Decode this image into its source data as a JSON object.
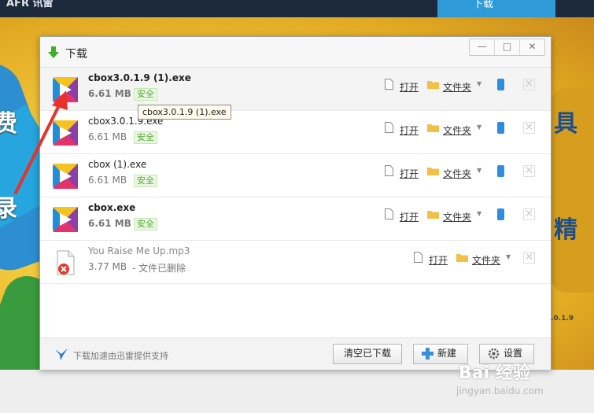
{
  "background_page": {
    "top_logo": "AFR 讯雷",
    "top_tab": "下载",
    "banner_words": [
      "费",
      "录",
      "具",
      "精"
    ],
    "banner_version": ".0.1.9"
  },
  "dialog": {
    "title": "下载",
    "window_buttons": {
      "minimize": "—",
      "maximize": "□",
      "close": "✕"
    },
    "tooltip": "cbox3.0.1.9 (1).exe",
    "files": [
      {
        "name": "cbox3.0.1.9 (1).exe",
        "size": "6.61 MB",
        "status": "安全",
        "open_label": "打开",
        "folder_label": "文件夹",
        "bold": true,
        "deleted": false,
        "highlight": true
      },
      {
        "name": "cbox3.0.1.9.exe",
        "size": "6.61 MB",
        "status": "安全",
        "open_label": "打开",
        "folder_label": "文件夹",
        "bold": false,
        "deleted": false,
        "highlight": false
      },
      {
        "name": "cbox (1).exe",
        "size": "6.61 MB",
        "status": "安全",
        "open_label": "打开",
        "folder_label": "文件夹",
        "bold": false,
        "deleted": false,
        "highlight": false
      },
      {
        "name": "cbox.exe",
        "size": "6.61 MB",
        "status": "安全",
        "open_label": "打开",
        "folder_label": "文件夹",
        "bold": true,
        "deleted": false,
        "highlight": false
      },
      {
        "name": "You Raise Me Up.mp3",
        "size": "3.77 MB",
        "status": "- 文件已删除",
        "open_label": "打开",
        "folder_label": "文件夹",
        "bold": false,
        "deleted": true,
        "highlight": false
      }
    ],
    "footer": {
      "info_text": "下载加速由迅雷提供支持",
      "clear_button": "清空已下载",
      "new_button": "新建",
      "settings_button": "设置"
    }
  },
  "watermark": {
    "text": "Bai 经验",
    "url": "jingyan.baidu.com"
  },
  "colors": {
    "accent_blue": "#2f9ad8",
    "safe_green": "#57a839",
    "annotation_red": "#e8312a"
  }
}
